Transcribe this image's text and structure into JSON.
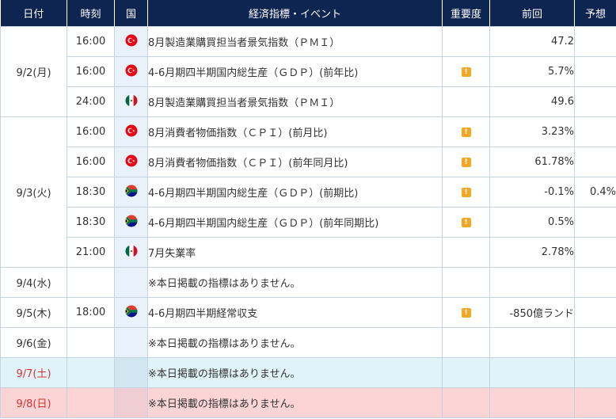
{
  "headers": {
    "date": "日付",
    "time": "時刻",
    "country": "国",
    "event": "経済指標・イベント",
    "importance": "重要度",
    "previous": "前回",
    "forecast": "予想"
  },
  "colors": {
    "header_bg": "#0f2551",
    "importance_icon": "#f5a623",
    "saturday_row": "#dff3f9",
    "sunday_row": "#fbd5d6",
    "weekend_date_text": "#d83232"
  },
  "no_event_text": "※本日掲載の指標はありません。",
  "importance_mark": "!",
  "days": [
    {
      "date": "9/2(月)",
      "events": [
        {
          "time": "16:00",
          "country": "turkey-flag-icon",
          "event": "8月製造業購買担当者景気指数（ＰＭＩ）",
          "importance": false,
          "previous": "47.2",
          "forecast": ""
        },
        {
          "time": "16:00",
          "country": "turkey-flag-icon",
          "event": "4-6月期四半期国内総生産（ＧＤＰ）(前年比)",
          "importance": true,
          "previous": "5.7%",
          "forecast": ""
        },
        {
          "time": "24:00",
          "country": "mexico-flag-icon",
          "event": "8月製造業購買担当者景気指数（ＰＭＩ）",
          "importance": false,
          "previous": "49.6",
          "forecast": ""
        }
      ]
    },
    {
      "date": "9/3(火)",
      "events": [
        {
          "time": "16:00",
          "country": "turkey-flag-icon",
          "event": "8月消費者物価指数（ＣＰＩ）(前月比)",
          "importance": true,
          "previous": "3.23%",
          "forecast": ""
        },
        {
          "time": "16:00",
          "country": "turkey-flag-icon",
          "event": "8月消費者物価指数（ＣＰＩ）(前年同月比)",
          "importance": true,
          "previous": "61.78%",
          "forecast": ""
        },
        {
          "time": "18:30",
          "country": "south-africa-flag-icon",
          "event": "4-6月期四半期国内総生産（ＧＤＰ）(前期比)",
          "importance": true,
          "previous": "-0.1%",
          "forecast": "0.4%"
        },
        {
          "time": "18:30",
          "country": "south-africa-flag-icon",
          "event": "4-6月期四半期国内総生産（ＧＤＰ）(前年同期比)",
          "importance": true,
          "previous": "0.5%",
          "forecast": ""
        },
        {
          "time": "21:00",
          "country": "mexico-flag-icon",
          "event": "7月失業率",
          "importance": false,
          "previous": "2.78%",
          "forecast": ""
        }
      ]
    },
    {
      "date": "9/4(水)",
      "events": []
    },
    {
      "date": "9/5(木)",
      "events": [
        {
          "time": "18:00",
          "country": "south-africa-flag-icon",
          "event": "4-6月期四半期経常収支",
          "importance": true,
          "previous": "-850億ランド",
          "forecast": ""
        }
      ]
    },
    {
      "date": "9/6(金)",
      "events": []
    },
    {
      "date": "9/7(土)",
      "weekend": "sat",
      "events": []
    },
    {
      "date": "9/8(日)",
      "weekend": "sun",
      "events": []
    }
  ]
}
